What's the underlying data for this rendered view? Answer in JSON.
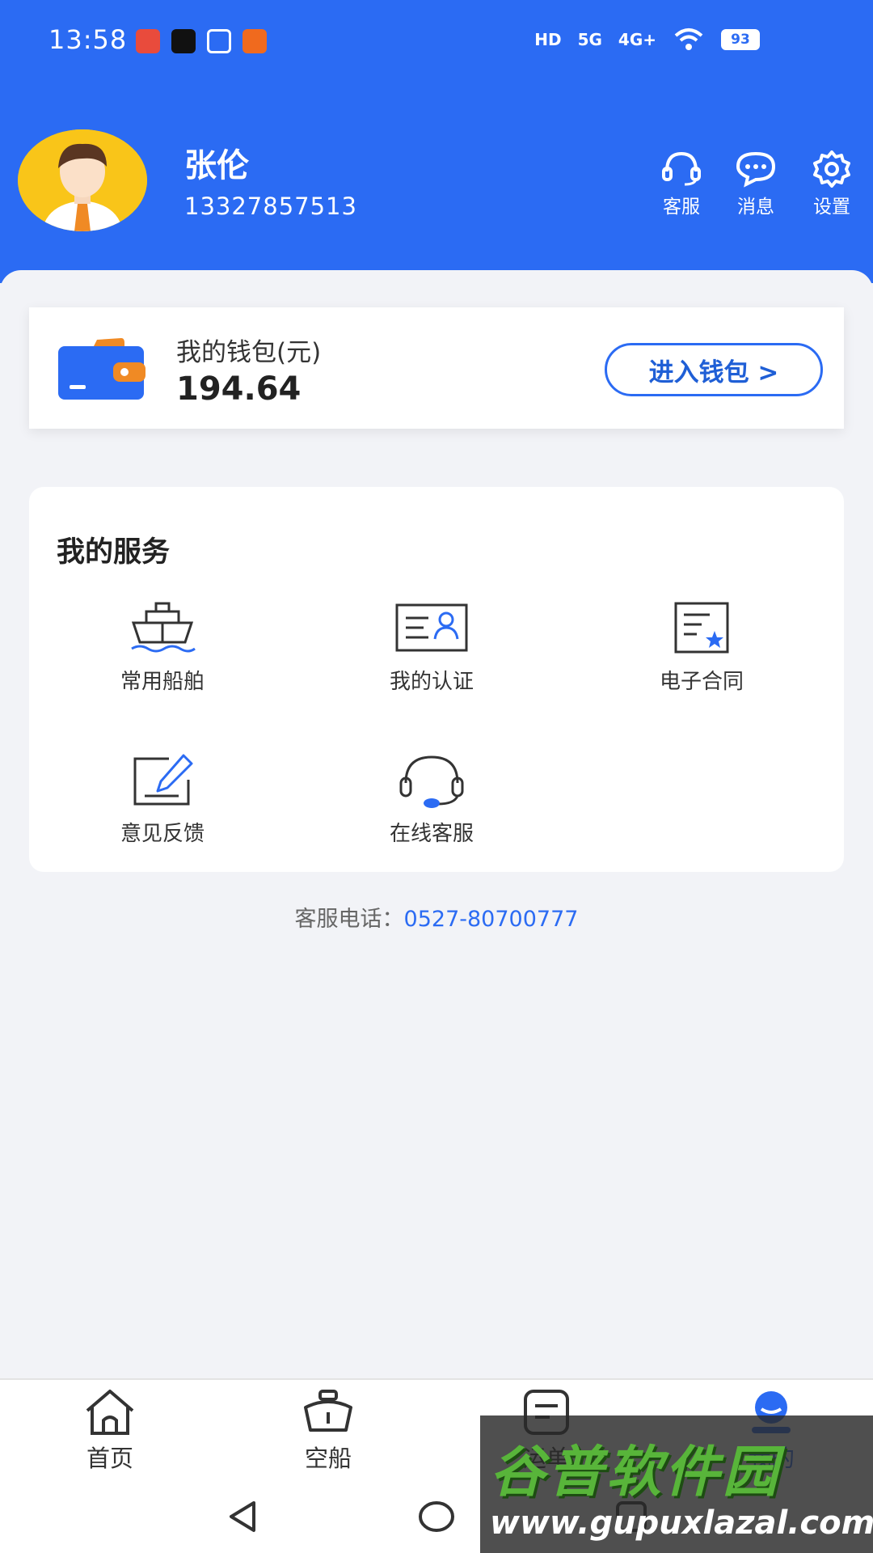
{
  "status_bar": {
    "time": "13:58",
    "hd": "HD",
    "net1": "5G",
    "net2": "4G+",
    "battery": "93"
  },
  "profile": {
    "name": "张伦",
    "phone": "13327857513"
  },
  "header_actions": [
    {
      "label": "客服",
      "icon": "headset-icon"
    },
    {
      "label": "消息",
      "icon": "chat-bubble-icon"
    },
    {
      "label": "设置",
      "icon": "gear-icon"
    }
  ],
  "wallet": {
    "title": "我的钱包(元)",
    "balance": "194.64",
    "button": "进入钱包 >"
  },
  "services": {
    "title": "我的服务",
    "items": [
      {
        "label": "常用船舶",
        "icon": "ship-icon"
      },
      {
        "label": "我的认证",
        "icon": "id-card-icon"
      },
      {
        "label": "电子合同",
        "icon": "contract-icon"
      },
      {
        "label": "意见反馈",
        "icon": "edit-icon"
      },
      {
        "label": "在线客服",
        "icon": "headset-icon"
      }
    ]
  },
  "hotline": {
    "label": "客服电话：",
    "number": "0527-80700777"
  },
  "bottom_nav": [
    {
      "label": "首页",
      "icon": "home-icon"
    },
    {
      "label": "空船",
      "icon": "ship-icon"
    },
    {
      "label": "运单",
      "icon": "order-icon"
    },
    {
      "label": "我的",
      "icon": "user-icon"
    }
  ],
  "watermark": {
    "title": "谷普软件园",
    "url": "www.gupuxlazal.com"
  },
  "colors": {
    "primary": "#2b6bf3",
    "background": "#f2f3f7",
    "wallet_orange": "#f08a24"
  }
}
